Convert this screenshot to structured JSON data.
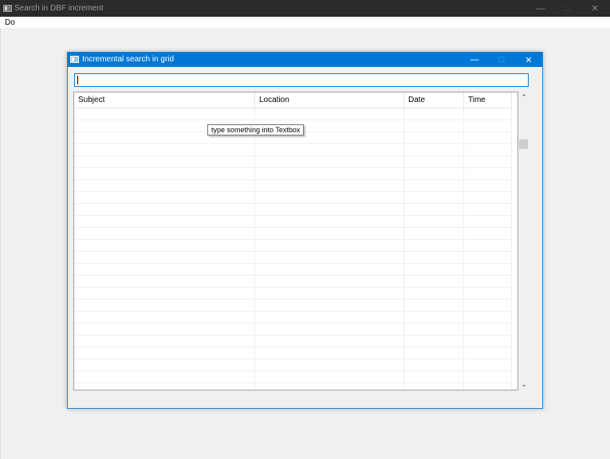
{
  "main_window": {
    "title": "Search in DBF increment",
    "menu": [
      "Do"
    ],
    "caption_buttons": [
      "—",
      "□",
      "✕"
    ]
  },
  "dialog": {
    "title": "Incremental search in grid",
    "caption_buttons": [
      "—",
      "□",
      "✕"
    ],
    "search": {
      "value": "",
      "placeholder": ""
    },
    "grid": {
      "columns": [
        "Subject",
        "Location",
        "Date",
        "Time"
      ],
      "rows": []
    },
    "scrollbar": {
      "up_icon": "chevron-up-icon",
      "down_icon": "chevron-down-icon"
    }
  },
  "tooltip": {
    "text": "type something into Textbox"
  },
  "colors": {
    "accent": "#0078d7",
    "outer_titlebar": "#2b2b2b",
    "background": "#f0f0f0"
  }
}
